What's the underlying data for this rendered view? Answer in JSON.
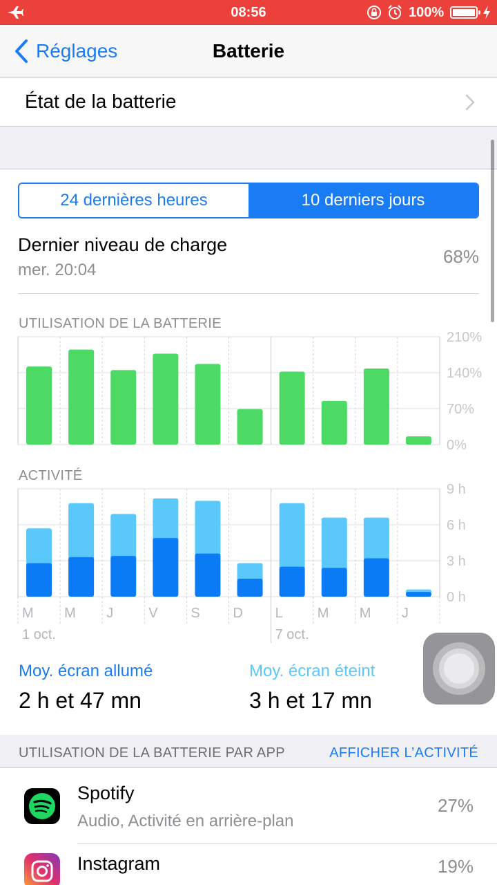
{
  "status_bar": {
    "time": "08:56",
    "battery_pct": "100%"
  },
  "nav": {
    "back_label": "Réglages",
    "title": "Batterie"
  },
  "health_row": {
    "label": "État de la batterie"
  },
  "segmented": {
    "options": [
      "24 dernières heures",
      "10 derniers jours"
    ],
    "selected_index": 1
  },
  "last_charge": {
    "label": "Dernier niveau de charge",
    "time": "mer. 20:04",
    "value": "68%"
  },
  "usage_section": {
    "title": "UTILISATION DE LA BATTERIE"
  },
  "activity_section": {
    "title": "ACTIVITÉ"
  },
  "averages": {
    "screen_on_label": "Moy. écran allumé",
    "screen_on_value": "2 h et 47 mn",
    "screen_off_label": "Moy. écran éteint",
    "screen_off_value": "3 h et 17 mn"
  },
  "app_section": {
    "title": "UTILISATION DE LA BATTERIE PAR APP",
    "action": "AFFICHER L’ACTIVITÉ"
  },
  "apps": [
    {
      "name": "Spotify",
      "detail": "Audio, Activité en arrière-plan",
      "percent": "27%"
    },
    {
      "name": "Instagram",
      "detail": "",
      "percent": "19%"
    }
  ],
  "colors": {
    "accent": "#1a7cf5",
    "status_bar": "#ec403a",
    "usage_bar": "#4cd964",
    "screen_on": "#0a7af5",
    "screen_off": "#5ac8fa"
  },
  "chart_data": [
    {
      "type": "bar",
      "title": "UTILISATION DE LA BATTERIE",
      "categories": [
        "M",
        "M",
        "J",
        "V",
        "S",
        "D",
        "L",
        "M",
        "M",
        "J"
      ],
      "week_labels": [
        "1 oct.",
        "7 oct."
      ],
      "yticks": [
        "0%",
        "70%",
        "140%",
        "210%"
      ],
      "ylim": [
        0,
        210
      ],
      "series": [
        {
          "values": [
            152,
            185,
            145,
            177,
            157,
            69,
            142,
            85,
            148,
            16
          ]
        }
      ]
    },
    {
      "type": "bar",
      "title": "ACTIVITÉ",
      "categories": [
        "M",
        "M",
        "J",
        "V",
        "S",
        "D",
        "L",
        "M",
        "M",
        "J"
      ],
      "week_labels": [
        "1 oct.",
        "7 oct."
      ],
      "yticks": [
        "0 h",
        "3 h",
        "6 h",
        "9 h"
      ],
      "ylim": [
        0,
        9
      ],
      "stacked": true,
      "series": [
        {
          "values": [
            2.8,
            3.3,
            3.4,
            4.9,
            3.6,
            1.5,
            2.5,
            2.4,
            3.2,
            0.4
          ]
        },
        {
          "values": [
            2.9,
            4.5,
            3.5,
            3.3,
            4.4,
            1.3,
            5.3,
            4.2,
            3.4,
            0.2
          ]
        }
      ]
    }
  ]
}
